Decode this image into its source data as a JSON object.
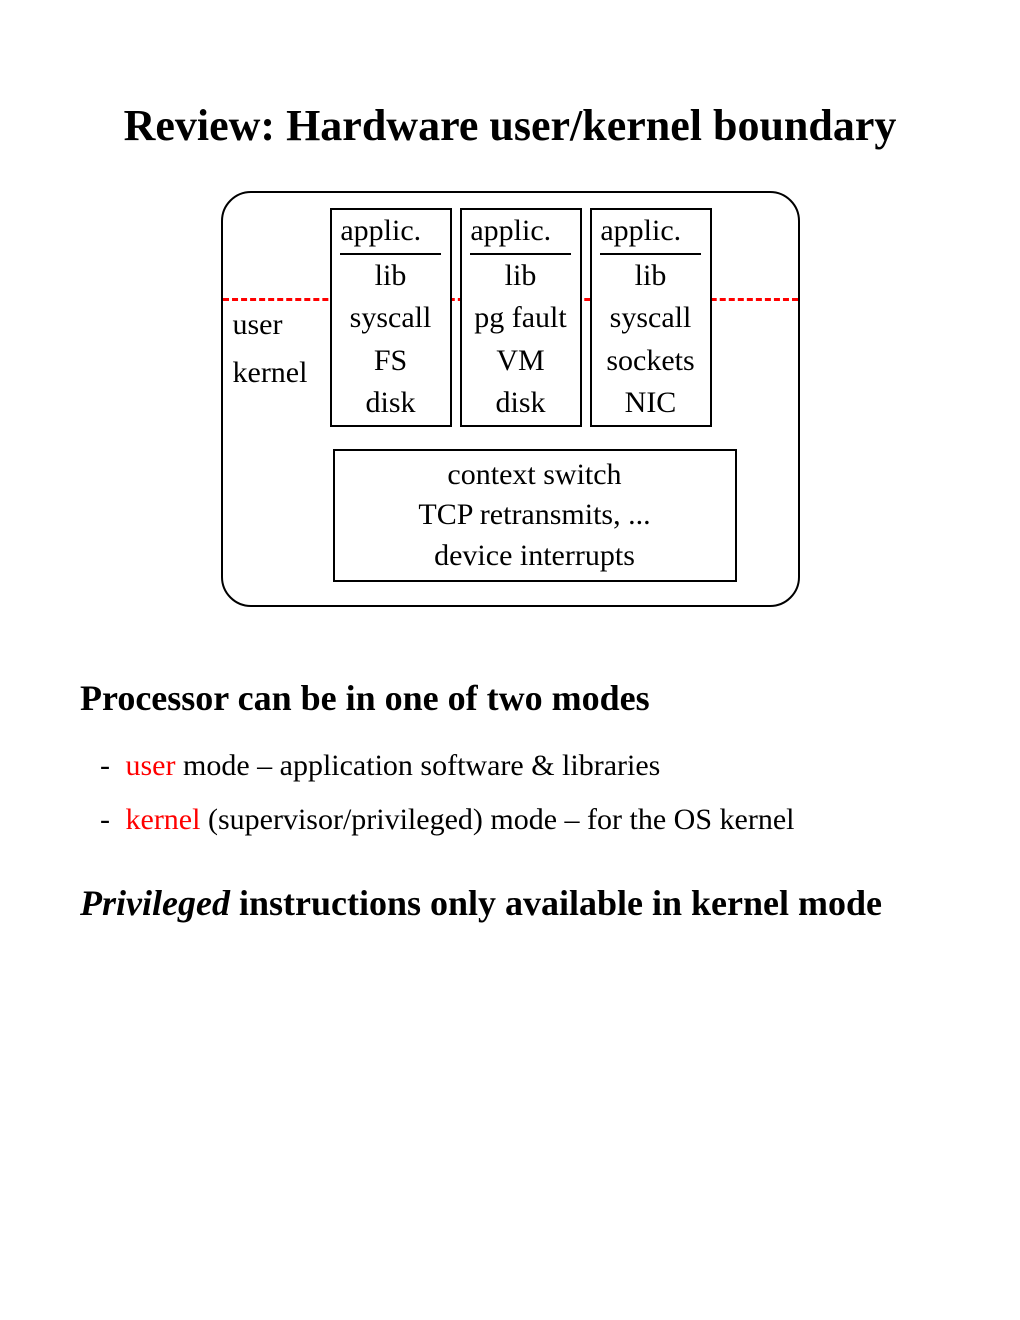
{
  "title": "Review: Hardware user/kernel boundary",
  "labels": {
    "user": "user",
    "kernel": "kernel"
  },
  "stacks": [
    {
      "applic": "applic.",
      "lib": "lib",
      "trap": "syscall",
      "mid": "FS",
      "dev": "disk"
    },
    {
      "applic": "applic.",
      "lib": "lib",
      "trap": "pg fault",
      "mid": "VM",
      "dev": "disk"
    },
    {
      "applic": "applic.",
      "lib": "lib",
      "trap": "syscall",
      "mid": "sockets",
      "dev": "NIC"
    }
  ],
  "bottom_box": {
    "l1": "context switch",
    "l2": "TCP retransmits, ...",
    "l3": "device interrupts"
  },
  "subheading1": "Processor can be in one of two modes",
  "bullets": [
    {
      "key": "user",
      "rest": " mode – application software & libraries"
    },
    {
      "key": "kernel",
      "rest": " (supervisor/privileged) mode – for the OS kernel"
    }
  ],
  "subheading2_italic": "Privileged",
  "subheading2_rest": " instructions only available in kernel mode"
}
